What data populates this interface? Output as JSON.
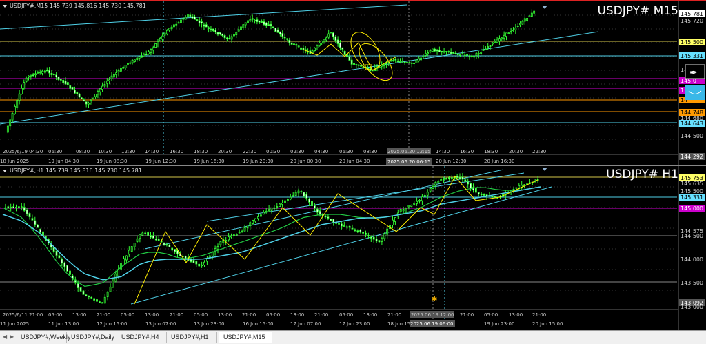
{
  "m15": {
    "header": "USDJPY#,M15  145.739 145.816 145.730 145.781",
    "symbol_label": "USDJPY# M15",
    "price_labels": [
      {
        "text": "145.781",
        "bg": "#ffffff",
        "fg": "#000000"
      },
      {
        "text": "145.720",
        "bg": "#000000",
        "fg": "#cccccc"
      },
      {
        "text": "145.500",
        "bg": "#ffff66",
        "fg": "#000000"
      },
      {
        "text": "145.331",
        "bg": "#66e0ff",
        "fg": "#000000"
      },
      {
        "text": "14",
        "bg": "#000000",
        "fg": "#cccccc"
      },
      {
        "text": "145.0",
        "bg": "#cc00cc",
        "fg": "#ffffff"
      },
      {
        "text": "1",
        "bg": "#cc00cc",
        "fg": "#ffffff"
      },
      {
        "text": "14",
        "bg": "#ff9900",
        "fg": "#000000"
      },
      {
        "text": "144.748",
        "bg": "#ff9900",
        "fg": "#000000"
      },
      {
        "text": "144.680",
        "bg": "#000000",
        "fg": "#cccccc"
      },
      {
        "text": "144.643",
        "bg": "#66e0ff",
        "fg": "#000000"
      },
      {
        "text": "144.500",
        "bg": "#000000",
        "fg": "#cccccc"
      },
      {
        "text": "144.292",
        "bg": "#555555",
        "fg": "#ffffff"
      }
    ],
    "time_labels": [
      "18 Jun 2025",
      "19 Jun 04:30",
      "19 Jun 08:30",
      "19 Jun 12:30",
      "19 Jun 16:30",
      "19 Jun 20:30",
      "20 Jun 00:30",
      "20 Jun 04:30",
      "20 Jun 08:30",
      "20 Jun 12:30",
      "20 Jun 16:30"
    ],
    "time_labels_upper": [
      "2025/6/19 04:30",
      "06:30",
      "08:30",
      "10:30",
      "12:30",
      "14:30",
      "16:30",
      "18:30",
      "20:30",
      "22:30",
      "00:30",
      "02:30",
      "04:30",
      "06:30",
      "08:30",
      "2025.06.20 12:15",
      "14:30",
      "16:30",
      "18:30",
      "20:30",
      "22:30"
    ],
    "crosshair_time": "2025.06.20 06:15"
  },
  "h1": {
    "header": "USDJPY#,H1  145.739 145.816 145.730 145.781",
    "symbol_label": "USDJPY# H1",
    "price_labels": [
      {
        "text": "145.753",
        "bg": "#ffff66",
        "fg": "#000000"
      },
      {
        "text": "145.635",
        "bg": "#000000",
        "fg": "#cccccc"
      },
      {
        "text": "145.500",
        "bg": "#000000",
        "fg": "#cccccc"
      },
      {
        "text": "145.331",
        "bg": "#66e0ff",
        "fg": "#000000"
      },
      {
        "text": "145.000",
        "bg": "#cc00cc",
        "fg": "#ffffff"
      },
      {
        "text": "144.575",
        "bg": "#000000",
        "fg": "#cccccc"
      },
      {
        "text": "144.500",
        "bg": "#000000",
        "fg": "#cccccc"
      },
      {
        "text": "144.000",
        "bg": "#000000",
        "fg": "#cccccc"
      },
      {
        "text": "143.500",
        "bg": "#000000",
        "fg": "#cccccc"
      },
      {
        "text": "143.092",
        "bg": "#555555",
        "fg": "#ffffff"
      },
      {
        "text": "143.000",
        "bg": "#000000",
        "fg": "#cccccc"
      }
    ],
    "time_labels_upper": [
      "2025/6/11 21:00",
      "05:00",
      "13:00",
      "21:00",
      "05:00",
      "13:00",
      "21:00",
      "05:00",
      "13:00",
      "21:00",
      "05:00",
      "13:00",
      "21:00",
      "05:00",
      "13:00",
      "21:00",
      "2025.06.19 12:00",
      "21:00",
      "05:00",
      "13:00",
      "21:00"
    ],
    "time_labels": [
      "11 Jun 2025",
      "11 Jun 13:00",
      "12 Jun 15:00",
      "13 Jun 07:00",
      "13 Jun 23:00",
      "16 Jun 15:00",
      "17 Jun 07:00",
      "17 Jun 23:00",
      "18 Jun 15",
      "2025.06.19 06:00",
      "19 Jun 23:00",
      "20 Jun 15:00"
    ]
  },
  "tabs": [
    "USDJPY#,Weekly",
    "USDJPY#,Daily",
    "USDJPY#,H4",
    "USDJPY#,H1",
    "USDJPY#,M15"
  ],
  "active_tab": "USDJPY#,M15"
}
